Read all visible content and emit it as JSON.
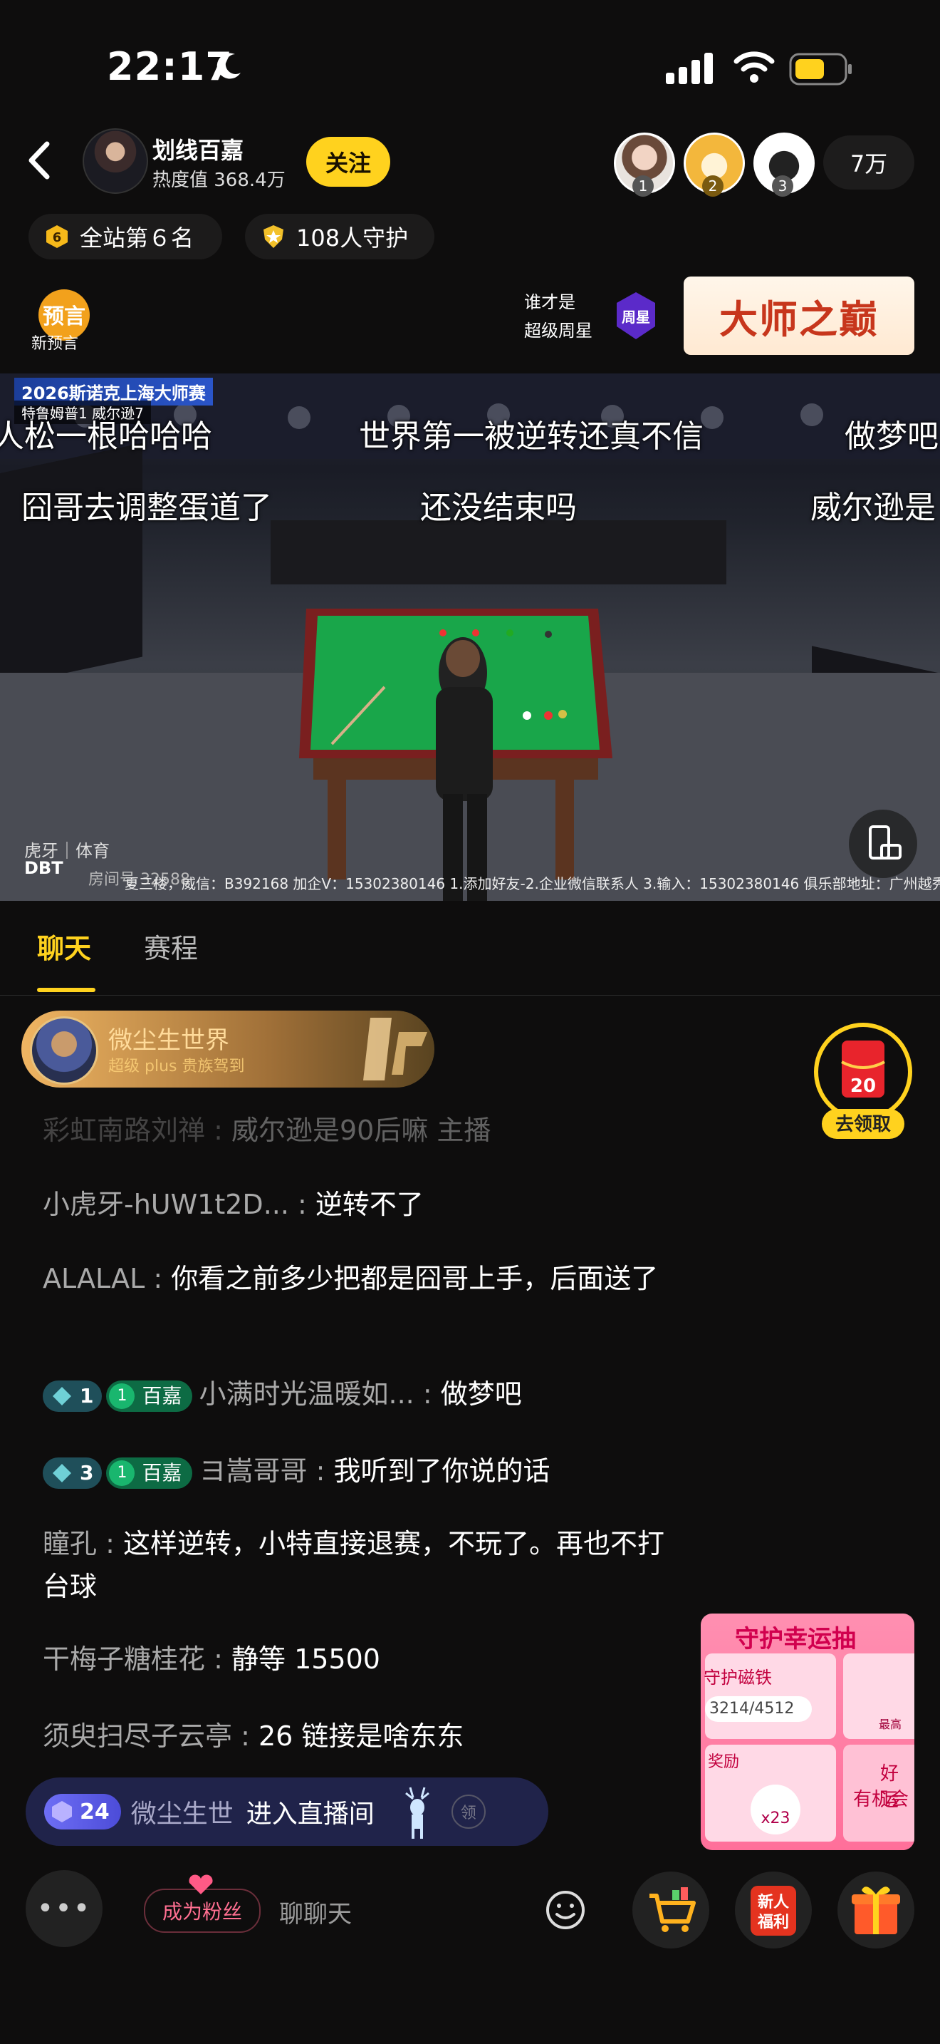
{
  "status_bar": {
    "time": "22:17"
  },
  "header": {
    "host_name": "划线百嘉",
    "heat": "热度值 368.4万",
    "follow_label": "关注",
    "viewer_ranks": [
      "1",
      "2",
      "3"
    ],
    "viewer_count": "7万",
    "rank_pill": "全站第６名",
    "rank_badge": "6",
    "guard_pill": "108人守护",
    "forecast_label": "新预言",
    "forecast_icon_text": "预言",
    "weekstar_question_1": "谁才是",
    "weekstar_question_2": "超级周星",
    "weekstar_badge": "周星",
    "master_banner": "大师之巅"
  },
  "video": {
    "event_title": "2026斯诺克上海大师赛",
    "scoreline": "特鲁姆普1  威尔逊7",
    "danmaku": [
      "人松一根哈哈哈",
      "世界第一被逆转还真不信",
      "做梦吧",
      "囧哥去调整蛋道了",
      "还没结束吗",
      "威尔逊是"
    ],
    "sponsor_text": "夏三楼，威信：B392168  加企V：15302380146 1.添加好友-2.企业微信联系人 3.输入：15302380146 俱乐部地址：广州越秀较场西路置地大",
    "platform_tag": "虎牙｜体育",
    "dbt_label": "DBT",
    "room_label": "房间号 32588"
  },
  "tabs": {
    "chat": "聊天",
    "schedule": "赛程"
  },
  "vip_banner": {
    "name": "微尘生世界",
    "subtitle": "超级 plus 贵族驾到"
  },
  "chat": [
    {
      "user": "彩虹南路刘禅",
      "text": "威尔逊是90后嘛 主播"
    },
    {
      "user": "小虎牙-hUW1t2D...",
      "text": "逆转不了"
    },
    {
      "user": "ALALAL",
      "text": "你看之前多少把都是囧哥上手，后面送了"
    },
    {
      "level": "1",
      "fan_level": "1",
      "fan_club": "百嘉",
      "user": "小满时光温暖如...",
      "text": "做梦吧"
    },
    {
      "level": "3",
      "fan_level": "1",
      "fan_club": "百嘉",
      "user": "ヨ嵩哥哥",
      "text": "我听到了你说的话"
    },
    {
      "user": "瞳孔",
      "text": "这样逆转，小特直接退赛，不玩了。再也不打台球"
    },
    {
      "user": "干梅子糖桂花",
      "text": "静等 15500"
    },
    {
      "user": "须臾扫尽子云亭",
      "text": "26 链接是啥东东"
    }
  ],
  "redpack": {
    "amount": "20",
    "label": "去领取"
  },
  "lucky_card": {
    "title": "守护幸运抽",
    "item1": "守护磁铁",
    "progress": "3214/4512",
    "reward_label": "奖励",
    "reward_count": "x23",
    "side1": "最高",
    "side2": "好运",
    "side3": "有机会"
  },
  "entry": {
    "level": "24",
    "user": "微尘生世",
    "text": "进入直播间",
    "badge": "领"
  },
  "bottom_bar": {
    "more": "•••",
    "fan_button": "成为粉丝",
    "chat_placeholder": "聊聊天",
    "newbie_label_1": "新人",
    "newbie_label_2": "福利"
  },
  "colors": {
    "accent": "#ffd21e",
    "background": "#0e0d0d",
    "banner_red": "#c7361c"
  }
}
